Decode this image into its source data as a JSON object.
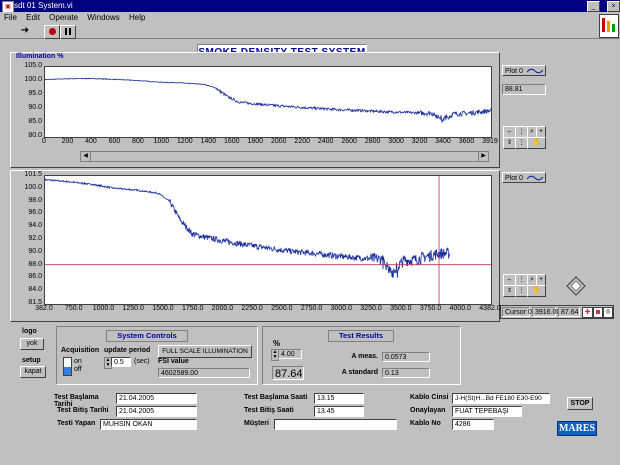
{
  "window": {
    "title": "sdt 01 System.vi"
  },
  "menu": [
    "File",
    "Edit",
    "Operate",
    "Windows",
    "Help"
  ],
  "header": {
    "title": "SMOKE DENSITY TEST SYSTEM"
  },
  "chart1": {
    "label": "Illumination %",
    "legend": "Plot 0",
    "readout": "88.81",
    "yticks": [
      "105.0",
      "100.0",
      "95.0",
      "90.0",
      "85.0",
      "80.0"
    ],
    "xticks": [
      "0",
      "200",
      "400",
      "600",
      "800",
      "1000",
      "1200",
      "1400",
      "1600",
      "1800",
      "2000",
      "2200",
      "2400",
      "2600",
      "2800",
      "3000",
      "3200",
      "3400",
      "3600",
      "3919"
    ]
  },
  "chart2": {
    "legend": "Plot 0",
    "yticks": [
      "101.5",
      "100.0",
      "98.0",
      "96.0",
      "94.0",
      "92.0",
      "90.0",
      "88.0",
      "86.0",
      "84.0",
      "81.5"
    ],
    "xticks": [
      "382.0",
      "750.0",
      "1000.0",
      "1250.0",
      "1500.0",
      "1750.0",
      "2000.0",
      "2250.0",
      "2500.0",
      "2750.0",
      "3000.0",
      "3250.0",
      "3500.0",
      "3750.0",
      "4000.0",
      "4382.0"
    ],
    "cursor_name": "Cursor 0",
    "cursor_x": "3916.00",
    "cursor_y": "87.64"
  },
  "chart_data": {
    "type": "line",
    "title": "",
    "xlabel": "",
    "ylabel": "Illumination %",
    "series": [
      {
        "name": "Plot 0",
        "x": [
          0,
          200,
          400,
          600,
          800,
          1000,
          1200,
          1400,
          1500,
          1600,
          1700,
          1800,
          2000,
          2200,
          2400,
          2600,
          2800,
          3000,
          3200,
          3400,
          3500,
          3600,
          3700,
          3800,
          3919
        ],
        "y": [
          100.5,
          100.8,
          100.9,
          100.6,
          100.2,
          99.6,
          99.3,
          98.8,
          97.5,
          94.5,
          92.5,
          92.0,
          91.3,
          90.7,
          90.2,
          89.7,
          89.4,
          89.0,
          88.7,
          88.5,
          86.5,
          88.3,
          88.4,
          88.9,
          89.4
        ]
      }
    ],
    "ylim_chart1": [
      80,
      105
    ],
    "xlim_chart1": [
      0,
      3919
    ],
    "ylim_chart2": [
      81.5,
      101.5
    ],
    "xlim_chart2": [
      382,
      4382
    ],
    "cursor": {
      "x": 3916,
      "y": 87.64
    }
  },
  "logo": {
    "label": "logo",
    "button": "yok"
  },
  "setup": {
    "label": "setup",
    "button": "kapat"
  },
  "system_controls": {
    "title": "System Controls",
    "acquisition_label": "Acquisition",
    "on_label": "on",
    "off_label": "off",
    "update_period_label": "update period",
    "update_period_value": "0.5",
    "update_period_unit": "(sec)",
    "full_scale_button": "FULL SCALE ILLUMINATION",
    "fsi_label": "FSI value",
    "fsi_value": "4602589.00"
  },
  "test_results": {
    "title": "Test Results",
    "pct_symbol": "%",
    "small_value": "4.00",
    "big_value": "87.64",
    "a_meas_label": "A meas.",
    "a_meas_value": "0.0573",
    "a_std_label": "A standard",
    "a_std_value": "0.13"
  },
  "form": {
    "test_baslama_tarihi_label": "Test Başlama Tarihi",
    "test_baslama_tarihi": "21.04.2005",
    "test_bitis_tarihi_label": "Test Bitiş Tarihi",
    "test_bitis_tarihi": "21.04.2005",
    "testi_yapan_label": "Testi Yapan",
    "testi_yapan": "MUHSİN OKAN",
    "test_baslama_saati_label": "Test Başlama Saati",
    "test_baslama_saati": "13.15",
    "test_bitis_saati_label": "Test Bitiş Saati",
    "test_bitis_saati": "13.45",
    "musteri_label": "Müşteri",
    "musteri": "",
    "kablo_cinsi_label": "Kablo Cinsi",
    "kablo_cinsi": "J-H(St)H...Bd FE180 E30-E90",
    "onaylayan_label": "Onaylayan",
    "onaylayan": "FUAT TEPEBAŞI",
    "kablo_no_label": "Kablo No",
    "kablo_no": "4286"
  },
  "stop_button": "STOP",
  "brand": "MARES",
  "colors": {
    "trace": "#1a2fa0",
    "cursor": "#c83050",
    "title_blue": "#0000a0",
    "brand_bg": "#1060c0"
  }
}
